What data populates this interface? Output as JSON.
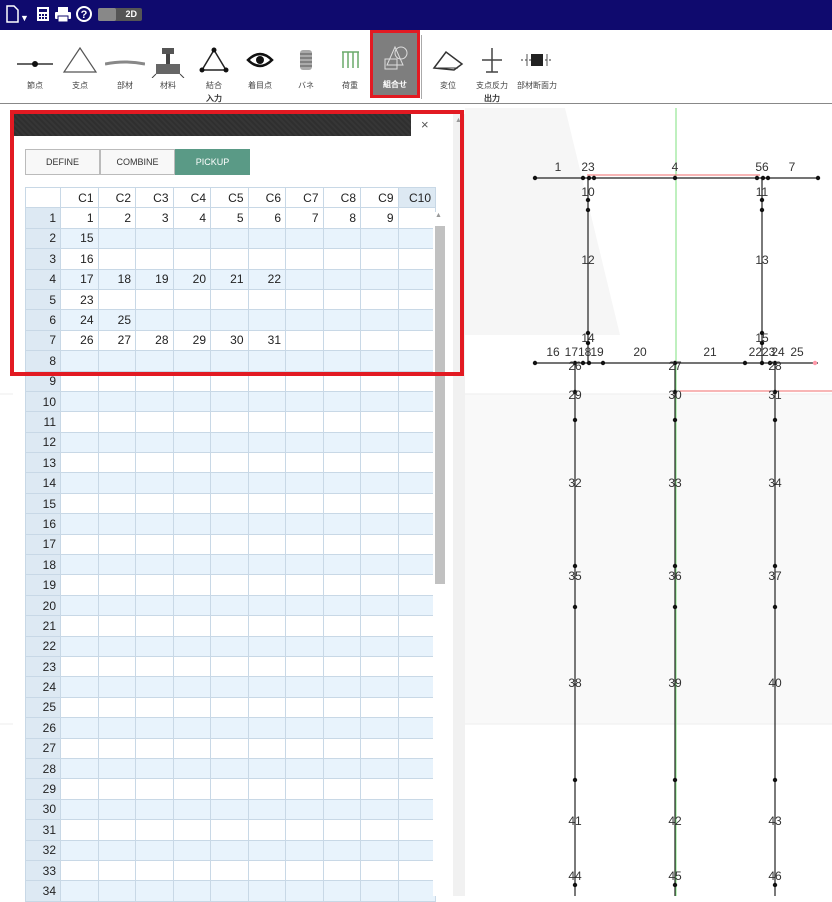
{
  "toolbar": {
    "mode": "2D"
  },
  "ribbon": {
    "buttons": [
      {
        "label": "節点",
        "icon": "node-icon"
      },
      {
        "label": "支点",
        "icon": "support-icon"
      },
      {
        "label": "部材",
        "icon": "member-icon"
      },
      {
        "label": "材料",
        "icon": "material-icon"
      },
      {
        "label": "結合",
        "icon": "joint-icon"
      },
      {
        "label": "着目点",
        "icon": "eye-icon"
      },
      {
        "label": "バネ",
        "icon": "spring-icon"
      },
      {
        "label": "荷重",
        "icon": "load-icon"
      },
      {
        "label": "組合せ",
        "icon": "combination-icon",
        "active": true
      },
      {
        "label": "変位",
        "icon": "displacement-icon"
      },
      {
        "label": "支点反力",
        "icon": "reaction-icon"
      },
      {
        "label": "部材断面力",
        "icon": "section-force-icon"
      }
    ],
    "groups": {
      "input": "入力",
      "output": "出力"
    }
  },
  "panel": {
    "close": "×",
    "tabs": [
      {
        "label": "DEFINE",
        "active": false
      },
      {
        "label": "COMBINE",
        "active": false
      },
      {
        "label": "PICKUP",
        "active": true
      }
    ],
    "grid": {
      "columns": [
        "C1",
        "C2",
        "C3",
        "C4",
        "C5",
        "C6",
        "C7",
        "C8",
        "C9",
        "C10"
      ],
      "rows": [
        {
          "id": "1",
          "cells": [
            "1",
            "2",
            "3",
            "4",
            "5",
            "6",
            "7",
            "8",
            "9",
            ""
          ]
        },
        {
          "id": "2",
          "cells": [
            "15",
            "",
            "",
            "",
            "",
            "",
            "",
            "",
            "",
            ""
          ]
        },
        {
          "id": "3",
          "cells": [
            "16",
            "",
            "",
            "",
            "",
            "",
            "",
            "",
            "",
            ""
          ]
        },
        {
          "id": "4",
          "cells": [
            "17",
            "18",
            "19",
            "20",
            "21",
            "22",
            "",
            "",
            "",
            ""
          ]
        },
        {
          "id": "5",
          "cells": [
            "23",
            "",
            "",
            "",
            "",
            "",
            "",
            "",
            "",
            ""
          ]
        },
        {
          "id": "6",
          "cells": [
            "24",
            "25",
            "",
            "",
            "",
            "",
            "",
            "",
            "",
            ""
          ]
        },
        {
          "id": "7",
          "cells": [
            "26",
            "27",
            "28",
            "29",
            "30",
            "31",
            "",
            "",
            "",
            ""
          ]
        },
        {
          "id": "8",
          "cells": [
            "",
            "",
            "",
            "",
            "",
            "",
            "",
            "",
            "",
            ""
          ]
        },
        {
          "id": "9",
          "cells": [
            "",
            "",
            "",
            "",
            "",
            "",
            "",
            "",
            "",
            ""
          ]
        },
        {
          "id": "10",
          "cells": [
            "",
            "",
            "",
            "",
            "",
            "",
            "",
            "",
            "",
            ""
          ]
        },
        {
          "id": "11",
          "cells": [
            "",
            "",
            "",
            "",
            "",
            "",
            "",
            "",
            "",
            ""
          ]
        },
        {
          "id": "12",
          "cells": [
            "",
            "",
            "",
            "",
            "",
            "",
            "",
            "",
            "",
            ""
          ]
        },
        {
          "id": "13",
          "cells": [
            "",
            "",
            "",
            "",
            "",
            "",
            "",
            "",
            "",
            ""
          ]
        },
        {
          "id": "14",
          "cells": [
            "",
            "",
            "",
            "",
            "",
            "",
            "",
            "",
            "",
            ""
          ]
        },
        {
          "id": "15",
          "cells": [
            "",
            "",
            "",
            "",
            "",
            "",
            "",
            "",
            "",
            ""
          ]
        },
        {
          "id": "16",
          "cells": [
            "",
            "",
            "",
            "",
            "",
            "",
            "",
            "",
            "",
            ""
          ]
        },
        {
          "id": "17",
          "cells": [
            "",
            "",
            "",
            "",
            "",
            "",
            "",
            "",
            "",
            ""
          ]
        },
        {
          "id": "18",
          "cells": [
            "",
            "",
            "",
            "",
            "",
            "",
            "",
            "",
            "",
            ""
          ]
        },
        {
          "id": "19",
          "cells": [
            "",
            "",
            "",
            "",
            "",
            "",
            "",
            "",
            "",
            ""
          ]
        },
        {
          "id": "20",
          "cells": [
            "",
            "",
            "",
            "",
            "",
            "",
            "",
            "",
            "",
            ""
          ]
        },
        {
          "id": "21",
          "cells": [
            "",
            "",
            "",
            "",
            "",
            "",
            "",
            "",
            "",
            ""
          ]
        },
        {
          "id": "22",
          "cells": [
            "",
            "",
            "",
            "",
            "",
            "",
            "",
            "",
            "",
            ""
          ]
        },
        {
          "id": "23",
          "cells": [
            "",
            "",
            "",
            "",
            "",
            "",
            "",
            "",
            "",
            ""
          ]
        },
        {
          "id": "24",
          "cells": [
            "",
            "",
            "",
            "",
            "",
            "",
            "",
            "",
            "",
            ""
          ]
        },
        {
          "id": "25",
          "cells": [
            "",
            "",
            "",
            "",
            "",
            "",
            "",
            "",
            "",
            ""
          ]
        },
        {
          "id": "26",
          "cells": [
            "",
            "",
            "",
            "",
            "",
            "",
            "",
            "",
            "",
            ""
          ]
        },
        {
          "id": "27",
          "cells": [
            "",
            "",
            "",
            "",
            "",
            "",
            "",
            "",
            "",
            ""
          ]
        },
        {
          "id": "28",
          "cells": [
            "",
            "",
            "",
            "",
            "",
            "",
            "",
            "",
            "",
            ""
          ]
        },
        {
          "id": "29",
          "cells": [
            "",
            "",
            "",
            "",
            "",
            "",
            "",
            "",
            "",
            ""
          ]
        },
        {
          "id": "30",
          "cells": [
            "",
            "",
            "",
            "",
            "",
            "",
            "",
            "",
            "",
            ""
          ]
        },
        {
          "id": "31",
          "cells": [
            "",
            "",
            "",
            "",
            "",
            "",
            "",
            "",
            "",
            ""
          ]
        },
        {
          "id": "32",
          "cells": [
            "",
            "",
            "",
            "",
            "",
            "",
            "",
            "",
            "",
            ""
          ]
        },
        {
          "id": "33",
          "cells": [
            "",
            "",
            "",
            "",
            "",
            "",
            "",
            "",
            "",
            ""
          ]
        },
        {
          "id": "34",
          "cells": [
            "",
            "",
            "",
            "",
            "",
            "",
            "",
            "",
            "",
            ""
          ]
        }
      ]
    }
  },
  "model_labels": [
    "1",
    "23",
    "4",
    "56",
    "7",
    "10",
    "11",
    "12",
    "13",
    "14",
    "15",
    "16",
    "1718",
    "19",
    "20",
    "21",
    "2223",
    "24",
    "25",
    "26",
    "27",
    "28",
    "29",
    "30",
    "31",
    "32",
    "33",
    "34",
    "35",
    "36",
    "37",
    "38",
    "39",
    "40",
    "41",
    "42",
    "43",
    "44",
    "45",
    "46"
  ],
  "colors": {
    "titlebar": "#0f0a6e",
    "active_tab": "#5a9a86",
    "highlight": "#e21a22",
    "grid_alt": "#e8f3fc"
  }
}
